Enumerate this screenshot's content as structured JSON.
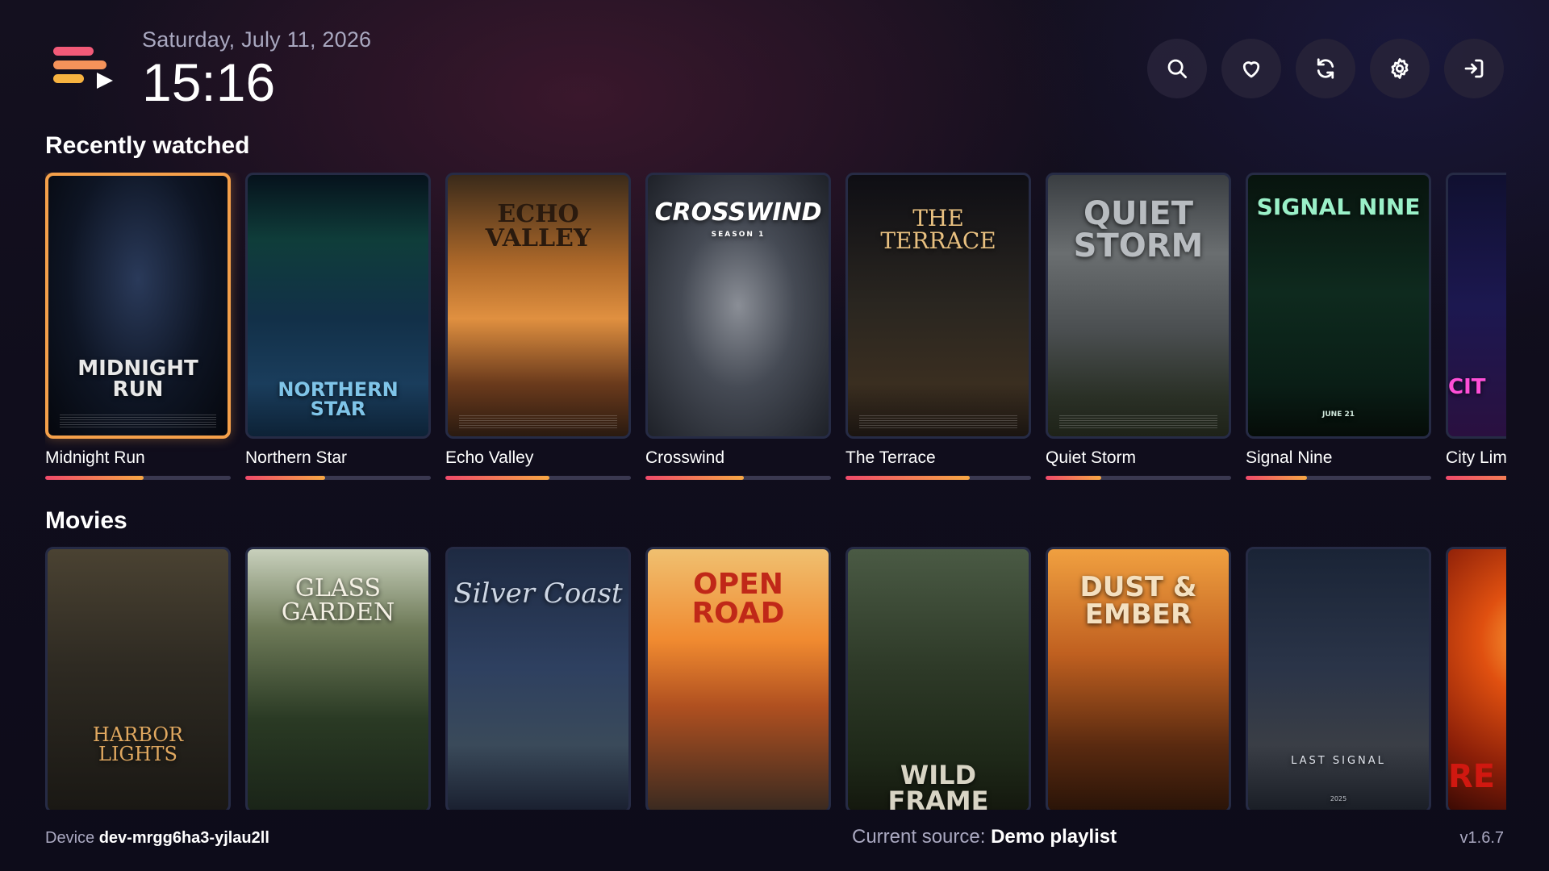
{
  "header": {
    "date": "Saturday, July 11, 2026",
    "time": "15:16",
    "logo_colors": [
      "#f25a78",
      "#f5935a",
      "#f7b340",
      "#ffffff"
    ],
    "actions": [
      {
        "icon": "search-icon",
        "label": "Search"
      },
      {
        "icon": "heart-icon",
        "label": "Favorites"
      },
      {
        "icon": "refresh-icon",
        "label": "Refresh"
      },
      {
        "icon": "gear-icon",
        "label": "Settings"
      },
      {
        "icon": "login-icon",
        "label": "Sign in"
      }
    ]
  },
  "recently_watched": {
    "title": "Recently watched",
    "items": [
      {
        "label": "Midnight Run",
        "poster_text": "MIDNIGHT RUN",
        "progress": 0.53,
        "focused": true
      },
      {
        "label": "Northern Star",
        "poster_text": "NORTHERN STAR",
        "progress": 0.43
      },
      {
        "label": "Echo Valley",
        "poster_text": "ECHO VALLEY",
        "progress": 0.56
      },
      {
        "label": "Crosswind",
        "poster_text": "CROSSWIND",
        "poster_sub": "SEASON 1",
        "progress": 0.53
      },
      {
        "label": "The Terrace",
        "poster_text": "THE TERRACE",
        "progress": 0.67
      },
      {
        "label": "Quiet Storm",
        "poster_text": "QUIET STORM",
        "progress": 0.3
      },
      {
        "label": "Signal Nine",
        "poster_text": "SIGNAL NINE",
        "poster_sub": "JUNE 21",
        "progress": 0.33
      },
      {
        "label": "City Lim",
        "poster_text": "CIT",
        "progress": 0.6
      }
    ]
  },
  "movies": {
    "title": "Movies",
    "items": [
      {
        "poster_text": "HARBOR LIGHTS"
      },
      {
        "poster_text": "GLASS GARDEN"
      },
      {
        "poster_text": "Silver Coast"
      },
      {
        "poster_text": "OPEN ROAD"
      },
      {
        "poster_text": "WILD FRAME"
      },
      {
        "poster_text": "DUST & EMBER"
      },
      {
        "poster_text": "LAST SIGNAL",
        "poster_sub": "2025"
      },
      {
        "poster_text": "RE"
      }
    ]
  },
  "footer": {
    "device_label": "Device",
    "device_id": "dev-mrgg6ha3-yjlau2ll",
    "source_label": "Current source:",
    "source_value": "Demo playlist",
    "version": "v1.6.7"
  }
}
